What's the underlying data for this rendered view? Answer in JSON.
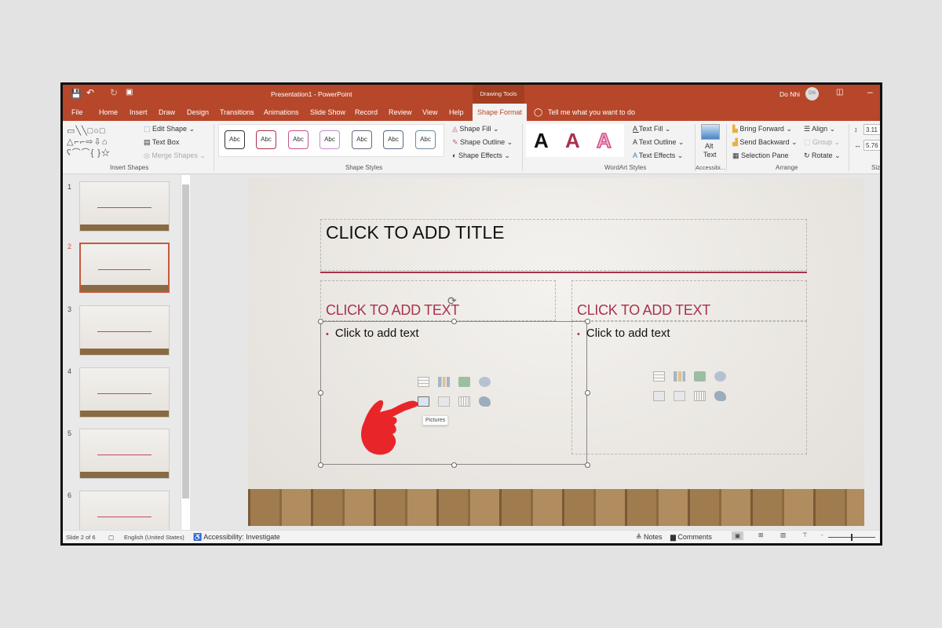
{
  "window": {
    "title": "Presentation1 - PowerPoint",
    "context_tab_group": "Drawing Tools",
    "user": "Do Nhi",
    "user_initials": "DN"
  },
  "tabs": [
    "File",
    "Home",
    "Insert",
    "Draw",
    "Design",
    "Transitions",
    "Animations",
    "Slide Show",
    "Record",
    "Review",
    "View",
    "Help",
    "Shape Format"
  ],
  "active_tab": "Shape Format",
  "tell_me": "Tell me what you want to do",
  "ribbon": {
    "insert_shapes": {
      "label": "Insert Shapes",
      "edit_shape": "Edit Shape",
      "text_box": "Text Box",
      "merge_shapes": "Merge Shapes"
    },
    "shape_styles": {
      "label": "Shape Styles",
      "preset": "Abc",
      "colors": [
        "#333333",
        "#a8334b",
        "#c2558b",
        "#c78bd0",
        "#666a80",
        "#5a6a88",
        "#6a8aa0"
      ],
      "shape_fill": "Shape Fill",
      "shape_outline": "Shape Outline",
      "shape_effects": "Shape Effects"
    },
    "wordart": {
      "label": "WordArt Styles",
      "letter": "A",
      "text_fill": "Text Fill",
      "text_outline": "Text Outline",
      "text_effects": "Text Effects"
    },
    "accessibility": {
      "label": "Accessibi...",
      "alt_text_1": "Alt",
      "alt_text_2": "Text"
    },
    "arrange": {
      "label": "Arrange",
      "bring_forward": "Bring Forward",
      "send_backward": "Send Backward",
      "selection_pane": "Selection Pane",
      "align": "Align",
      "group": "Group",
      "rotate": "Rotate"
    },
    "size": {
      "label": "Size",
      "height": "3.11",
      "width": "5.76"
    }
  },
  "thumbnails": {
    "numbers": [
      "1",
      "2",
      "3",
      "4",
      "5",
      "6"
    ],
    "selected": "2"
  },
  "slide": {
    "title": "CLICK TO ADD TITLE",
    "left_heading": "CLICK TO ADD TEXT",
    "right_heading": "CLICK TO ADD TEXT",
    "left_body": "Click to add text",
    "right_body": "Click to add text",
    "tooltip": "Pictures"
  },
  "status": {
    "slide": "Slide 2 of 6",
    "language": "English (United States)",
    "accessibility": "Accessibility: Investigate",
    "notes": "Notes",
    "comments": "Comments"
  }
}
